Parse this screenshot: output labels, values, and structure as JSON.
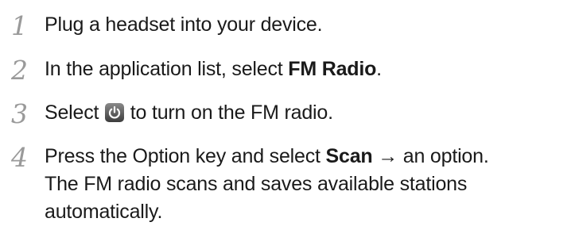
{
  "steps": [
    {
      "number": "1",
      "text": "Plug a headset into your device."
    },
    {
      "number": "2",
      "text_before": "In the application list, select ",
      "bold": "FM Radio",
      "text_after": "."
    },
    {
      "number": "3",
      "text_before": "Select ",
      "icon": "power-icon",
      "text_after": " to turn on the FM radio."
    },
    {
      "number": "4",
      "text_before": "Press the Option key and select ",
      "bold": "Scan",
      "text_after": " → an option.",
      "line2": "The FM radio scans and saves available stations",
      "line3": "automatically."
    }
  ]
}
